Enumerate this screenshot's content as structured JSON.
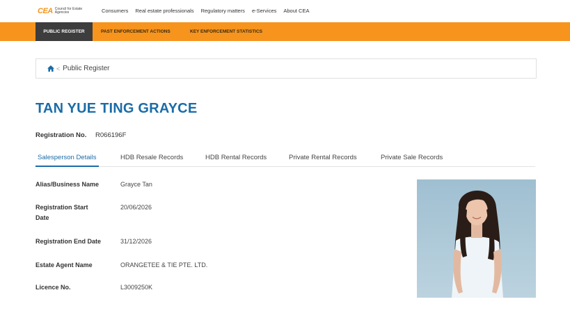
{
  "logo": {
    "mark": "CEA",
    "text": "Council for Estate Agencies"
  },
  "topnav": {
    "links": [
      "Consumers",
      "Real estate professionals",
      "Regulatory matters",
      "e-Services",
      "About CEA"
    ]
  },
  "subnav": {
    "items": [
      "PUBLIC REGISTER",
      "PAST ENFORCEMENT ACTIONS",
      "KEY ENFORCEMENT STATISTICS"
    ],
    "active_index": 0
  },
  "breadcrumb": {
    "separator": "<",
    "current": "Public Register"
  },
  "profile": {
    "name": "TAN YUE TING GRAYCE",
    "registration_label": "Registration No.",
    "registration_no": "R066196F"
  },
  "tabs": {
    "items": [
      "Salesperson Details",
      "HDB Resale Records",
      "HDB Rental Records",
      "Private Rental Records",
      "Private Sale Records"
    ],
    "active_index": 0
  },
  "details": [
    {
      "label": "Alias/Business Name",
      "value": "Grayce Tan"
    },
    {
      "label": "Registration Start Date",
      "value": "20/06/2026"
    },
    {
      "label": "Registration End Date",
      "value": "31/12/2026"
    },
    {
      "label": "Estate Agent Name",
      "value": "ORANGETEE & TIE PTE. LTD."
    },
    {
      "label": "Licence No.",
      "value": "L3009250K"
    }
  ],
  "colors": {
    "accent": "#f7941d",
    "title_blue": "#1b6ca8",
    "active_nav": "#3d3d3d",
    "photo_bg": "#aac6d6"
  }
}
